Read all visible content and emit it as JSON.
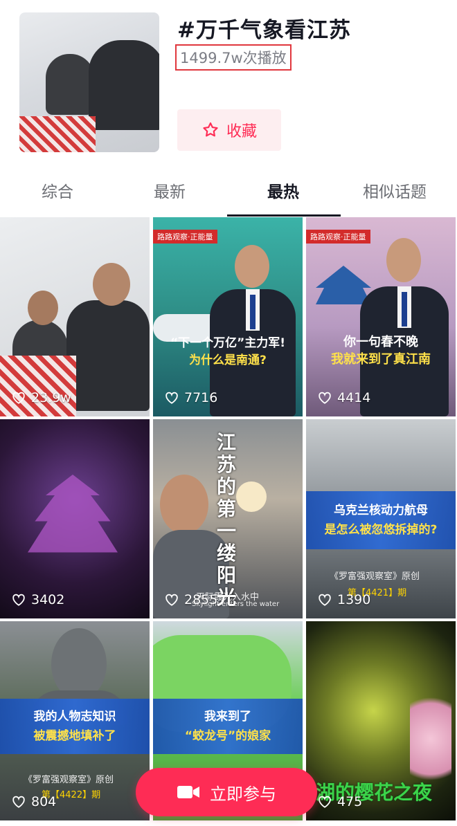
{
  "topic": {
    "title": "#万千气象看江苏",
    "plays": "1499.7w次播放",
    "favorite_label": "收藏"
  },
  "tabs": [
    {
      "label": "综合"
    },
    {
      "label": "最新"
    },
    {
      "label": "最热"
    },
    {
      "label": "相似话题"
    }
  ],
  "videos": [
    {
      "likes": "23.9w"
    },
    {
      "likes": "7716",
      "tag": "路路观察·正能量",
      "caption1": "“下一个万亿”主力军!",
      "caption2": "为什么是南通?"
    },
    {
      "likes": "4414",
      "tag": "路路观察·正能量",
      "caption1": "你一句春不晚",
      "caption2": "我就来到了真江南"
    },
    {
      "likes": "3402"
    },
    {
      "likes": "2855",
      "vertical_text": "江苏的第一缕阳光",
      "sub1": "天际霞光入水中",
      "sub2": "Skylight enters the water"
    },
    {
      "likes": "1390",
      "caption1": "乌克兰核动力航母",
      "caption2": "是怎么被忽悠拆掉的?",
      "source": "《罗富强观察室》原创",
      "episode": "第【4421】期"
    },
    {
      "likes": "804",
      "caption1": "我的人物志知识",
      "caption2": "被震撼地填补了",
      "source": "《罗富强观察室》原创",
      "episode": "第【4422】期"
    },
    {
      "likes": "",
      "caption1": "我来到了",
      "caption2": "“蛟龙号”的娘家"
    },
    {
      "likes": "475",
      "caption1": "湖的樱花之夜"
    }
  ],
  "participate": {
    "label": "立即参与"
  },
  "colors": {
    "accent": "#fe2c55",
    "accent_bg": "#fdeef0",
    "highlight_border": "#e0373d"
  }
}
